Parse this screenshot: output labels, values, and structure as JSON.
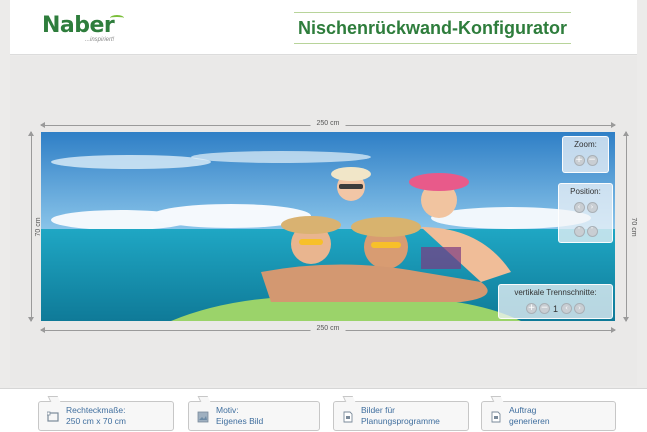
{
  "brand": {
    "name": "Naber",
    "tagline": "...inspiriert!"
  },
  "header": {
    "title": "Nischenrückwand-Konfigurator"
  },
  "dimensions": {
    "top": "250 cm",
    "bottom": "250 cm",
    "left": "70 cm",
    "right": "70 cm"
  },
  "controls": {
    "zoom": {
      "label": "Zoom:"
    },
    "position": {
      "label": "Position:"
    },
    "cuts": {
      "label": "vertikale Trennschnitte:",
      "value": "1"
    }
  },
  "footer": {
    "buttons": [
      {
        "line1": "Rechteckmaße:",
        "line2": "250 cm x 70 cm",
        "icon": "rectangle-icon"
      },
      {
        "line1": "Motiv:",
        "line2": "Eigenes Bild",
        "icon": "image-icon"
      },
      {
        "line1": "Bilder für",
        "line2": "Planungsprogramme",
        "icon": "document-icon"
      },
      {
        "line1": "Auftrag",
        "line2": "generieren",
        "icon": "document-icon"
      }
    ]
  },
  "colors": {
    "brand_green": "#2e7d3c",
    "link_blue": "#3f6e9e"
  }
}
